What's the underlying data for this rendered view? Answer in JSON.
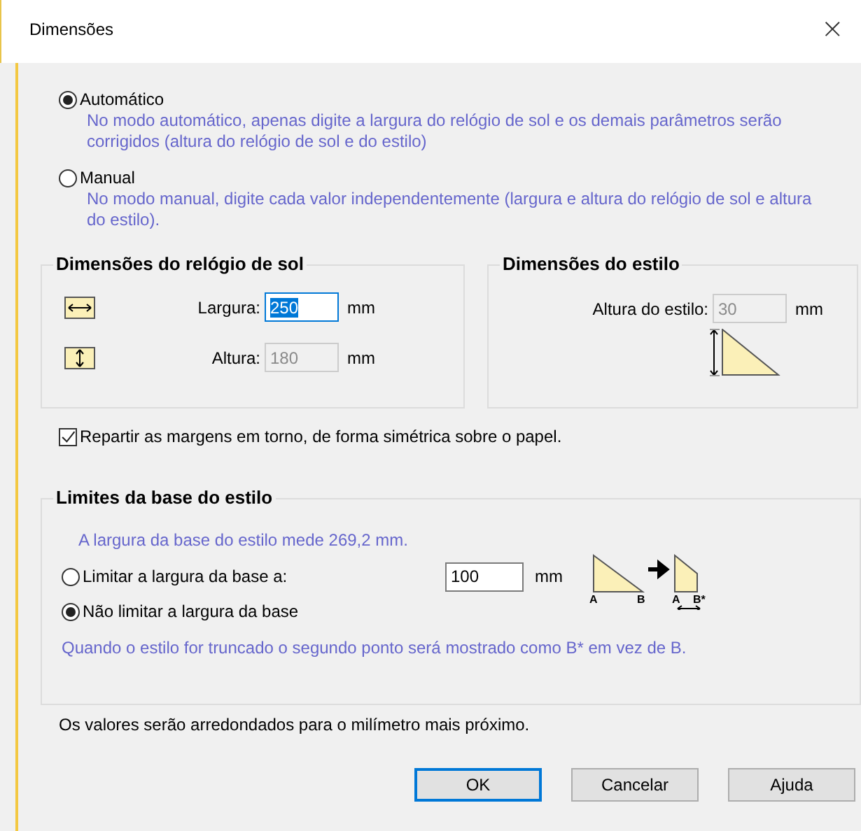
{
  "window": {
    "title": "Dimensões",
    "close": "×"
  },
  "modes": [
    {
      "label": "Automático",
      "selected": true,
      "description": "No modo automático, apenas digite a largura do relógio de sol e os demais parâmetros serão corrigidos (altura do relógio de sol e do estilo)"
    },
    {
      "label": "Manual",
      "selected": false,
      "description": "No modo manual, digite cada valor independentemente (largura e altura do relógio de sol e altura do estilo)."
    }
  ],
  "dial_group": {
    "title": "Dimensões do relógio de sol",
    "fields": [
      {
        "kind": "width",
        "label": "Largura:",
        "value": "250",
        "unit": "mm",
        "disabled": false,
        "focused": true
      },
      {
        "kind": "height",
        "label": "Altura:",
        "value": "180",
        "unit": "mm",
        "disabled": true,
        "focused": false
      }
    ]
  },
  "style_group": {
    "title": "Dimensões do estilo",
    "field": {
      "label": "Altura do estilo:",
      "value": "30",
      "unit": "mm",
      "disabled": true
    }
  },
  "symmetric_margins": {
    "label": "Repartir as margens em torno, de forma simétrica sobre o papel.",
    "checked": true
  },
  "base_group": {
    "title": "Limites da base do estilo",
    "info": "A largura da base do estilo mede 269,2 mm.",
    "options": [
      {
        "label": "Limitar a largura da base a:",
        "selected": false,
        "value": "100",
        "unit": "mm"
      },
      {
        "label": "Não limitar a largura da base",
        "selected": true
      }
    ],
    "diagram": {
      "left_a": "A",
      "left_b": "B",
      "right_a": "A",
      "right_b": "B*"
    },
    "note": "Quando o estilo for truncado o segundo ponto será mostrado como  B* em vez de B."
  },
  "rounding_note": "Os valores serão arredondados para o milímetro mais próximo.",
  "buttons": [
    {
      "label": "OK",
      "default": true
    },
    {
      "label": "Cancelar",
      "default": false
    },
    {
      "label": "Ajuda",
      "default": false
    }
  ]
}
